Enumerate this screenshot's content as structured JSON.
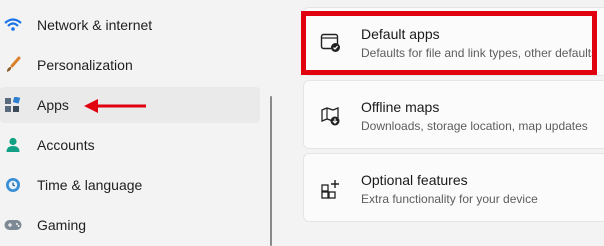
{
  "sidebar": {
    "items": [
      {
        "label": "Network & internet",
        "icon": "wifi-icon"
      },
      {
        "label": "Personalization",
        "icon": "brush-icon"
      },
      {
        "label": "Apps",
        "icon": "apps-icon",
        "selected": true
      },
      {
        "label": "Accounts",
        "icon": "person-icon"
      },
      {
        "label": "Time & language",
        "icon": "globe-clock-icon"
      },
      {
        "label": "Gaming",
        "icon": "gamepad-icon"
      }
    ]
  },
  "main": {
    "cards": [
      {
        "title": "Default apps",
        "subtitle": "Defaults for file and link types, other defaults",
        "icon": "default-apps-icon"
      },
      {
        "title": "Offline maps",
        "subtitle": "Downloads, storage location, map updates",
        "icon": "map-download-icon"
      },
      {
        "title": "Optional features",
        "subtitle": "Extra functionality for your device",
        "icon": "add-features-icon"
      }
    ]
  },
  "annotation": {
    "highlight_color": "#e00010",
    "arrow_color": "#e00010"
  }
}
